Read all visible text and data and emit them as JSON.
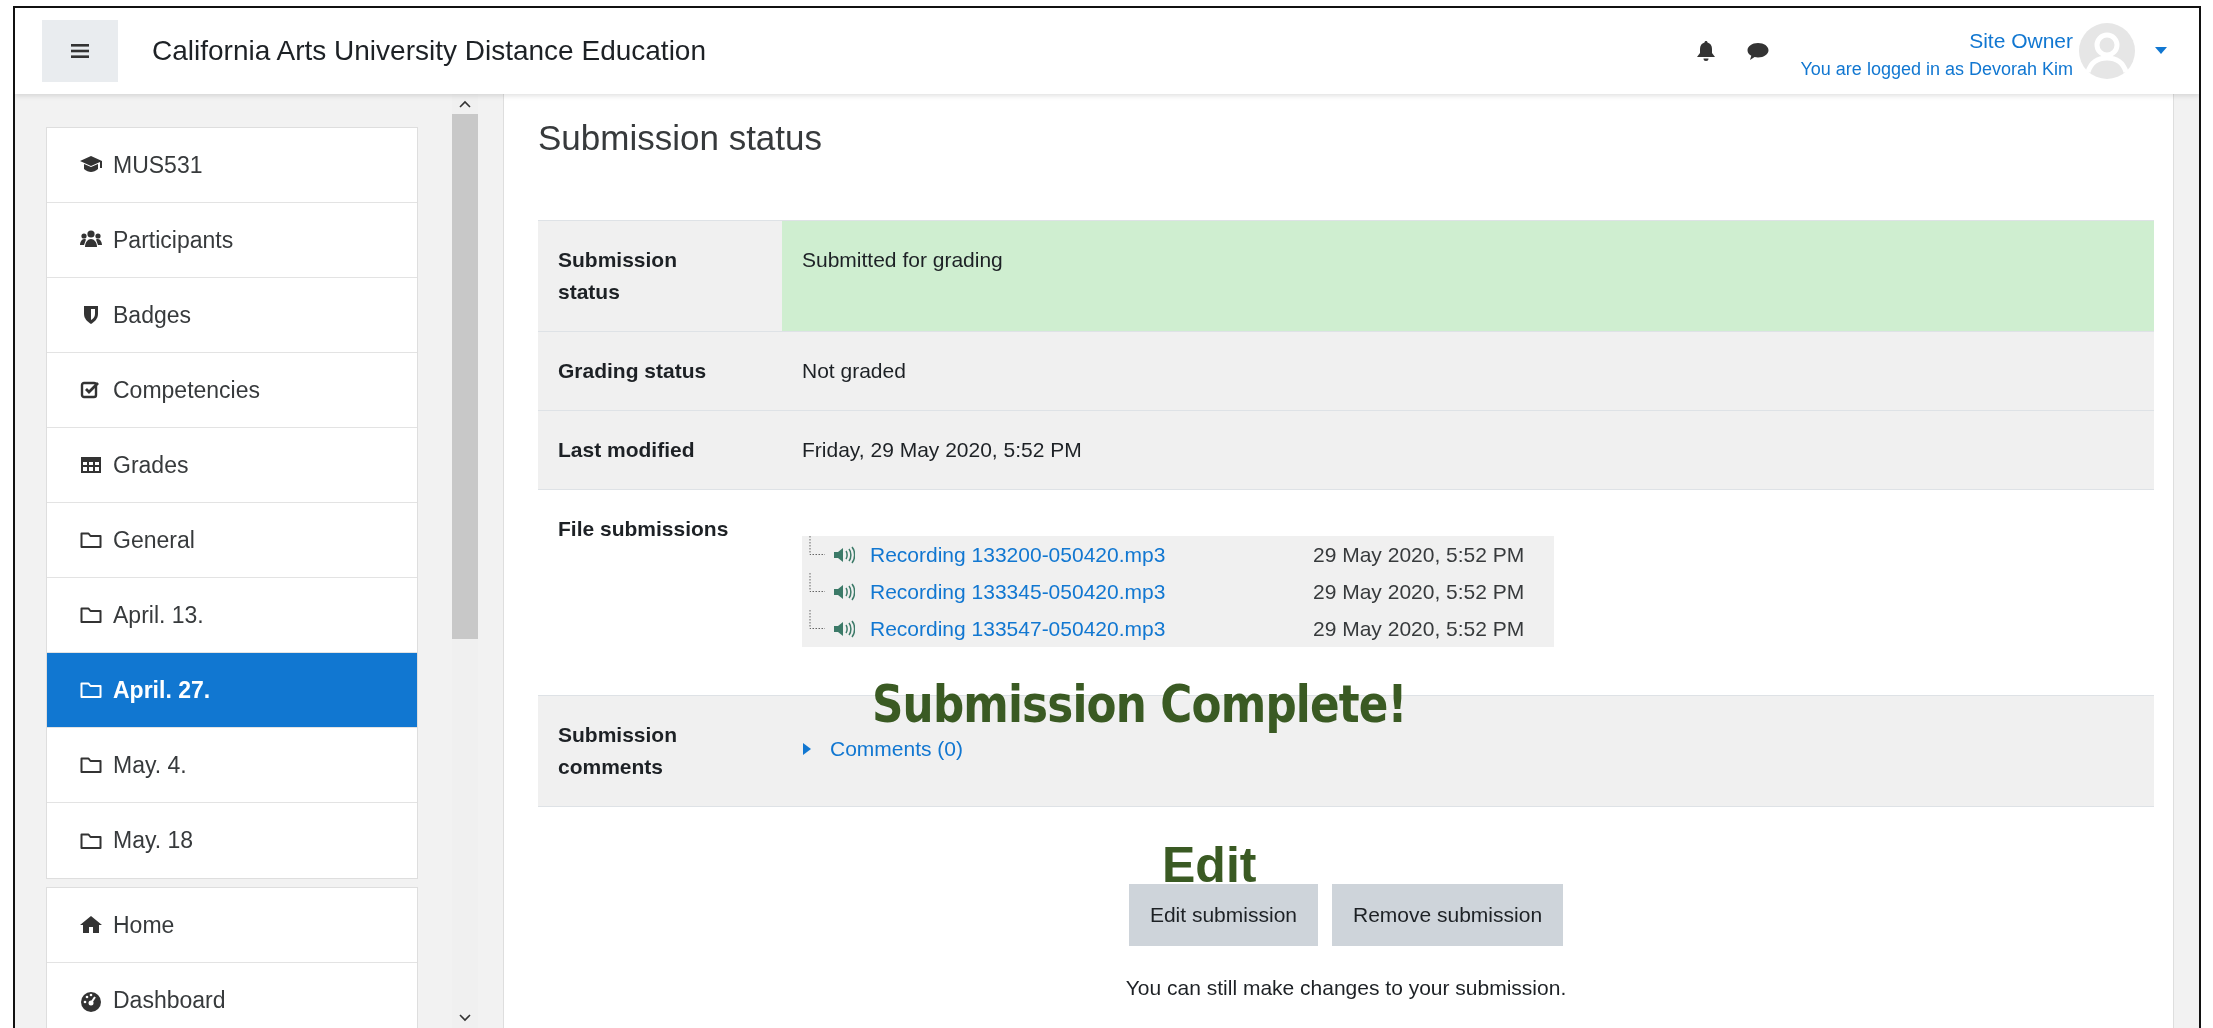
{
  "header": {
    "title": "California Arts University Distance Education",
    "user": {
      "name": "Site Owner",
      "login_note": "You are logged in as Devorah Kim"
    }
  },
  "sidebar": {
    "groups": [
      {
        "items": [
          {
            "kind": "course",
            "label": "MUS531",
            "selected": false
          },
          {
            "kind": "people",
            "label": "Participants",
            "selected": false
          },
          {
            "kind": "badge",
            "label": "Badges",
            "selected": false
          },
          {
            "kind": "competency",
            "label": "Competencies",
            "selected": false
          },
          {
            "kind": "grades",
            "label": "Grades",
            "selected": false
          },
          {
            "kind": "section",
            "label": "General",
            "selected": false
          },
          {
            "kind": "section",
            "label": "April. 13.",
            "selected": false
          },
          {
            "kind": "section",
            "label": "April. 27.",
            "selected": true
          },
          {
            "kind": "section",
            "label": "May. 4.",
            "selected": false
          },
          {
            "kind": "section",
            "label": "May. 18",
            "selected": false
          }
        ]
      },
      {
        "items": [
          {
            "kind": "home",
            "label": "Home",
            "selected": false
          },
          {
            "kind": "dashboard",
            "label": "Dashboard",
            "selected": false
          }
        ]
      }
    ]
  },
  "main": {
    "heading": "Submission status",
    "table": {
      "rows": [
        {
          "label": "Submission status",
          "highlighted": true,
          "shaded": true,
          "kind": "text",
          "value": "Submitted for grading"
        },
        {
          "label": "Grading status",
          "highlighted": false,
          "shaded": true,
          "kind": "text",
          "value": "Not graded"
        },
        {
          "label": "Last modified",
          "highlighted": false,
          "shaded": true,
          "kind": "text",
          "value": "Friday, 29 May 2020, 5:52 PM"
        },
        {
          "label": "File submissions",
          "highlighted": false,
          "shaded": false,
          "kind": "files",
          "files": [
            {
              "name": "Recording 133200-050420.mp3",
              "date": "29 May 2020, 5:52 PM"
            },
            {
              "name": "Recording 133345-050420.mp3",
              "date": "29 May 2020, 5:52 PM"
            },
            {
              "name": "Recording 133547-050420.mp3",
              "date": "29 May 2020, 5:52 PM"
            }
          ]
        },
        {
          "label": "Submission comments",
          "highlighted": false,
          "shaded": true,
          "kind": "comments",
          "toggle": "Comments (0)",
          "expanded": false
        }
      ]
    },
    "buttons": [
      "Edit submission",
      "Remove submission"
    ],
    "note": "You can still make changes to your submission."
  },
  "overlays": [
    {
      "kind": "banner",
      "text": "Submission Complete!"
    },
    {
      "kind": "label",
      "text": "Edit"
    }
  ]
}
